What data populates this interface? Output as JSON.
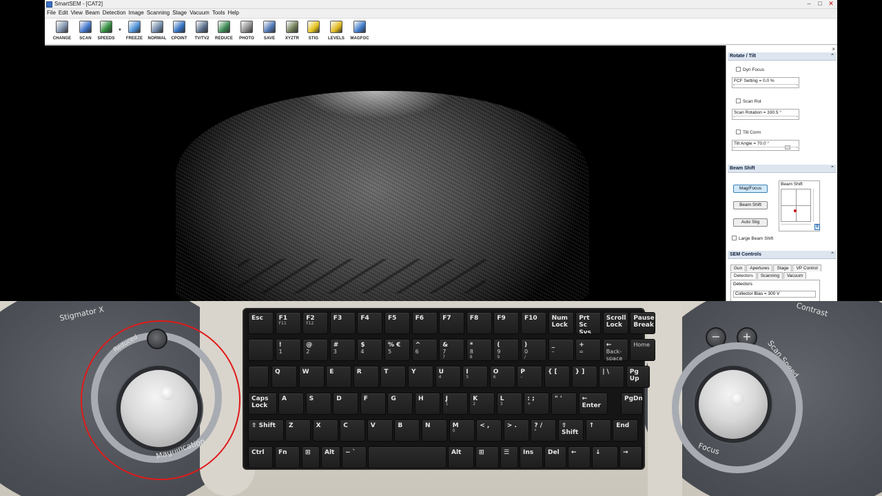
{
  "window": {
    "title": "SmartSEM - [CAT2]",
    "controls": {
      "minimize": "–",
      "maximize": "□",
      "close": "✕"
    }
  },
  "menu": [
    "File",
    "Edit",
    "View",
    "Beam",
    "Detection",
    "Image",
    "Scanning",
    "Stage",
    "Vacuum",
    "Tools",
    "Help"
  ],
  "toolbar": [
    {
      "label": "CHANGE",
      "icon": "change-icon",
      "color": "#7d8fa8"
    },
    {
      "label": "SCAN",
      "icon": "scan-icon",
      "color": "#3f73c8"
    },
    {
      "label": "SPEEDS",
      "icon": "speeds-icon",
      "color": "#2e8a3a"
    },
    {
      "label": "FREEZE",
      "icon": "freeze-icon",
      "color": "#4c8fd6"
    },
    {
      "label": "NORMAL",
      "icon": "normal-icon",
      "color": "#6f88a8"
    },
    {
      "label": "CPOINT",
      "icon": "cpoint-icon",
      "color": "#2f6fbf"
    },
    {
      "label": "TV/TV2",
      "icon": "tv-icon",
      "color": "#5a6f8c"
    },
    {
      "label": "REDUCE",
      "icon": "reduce-icon",
      "color": "#3c8a54"
    },
    {
      "label": "PHOTO",
      "icon": "photo-icon",
      "color": "#8a8a8a"
    },
    {
      "label": "SAVE",
      "icon": "save-icon",
      "color": "#4f75b5"
    },
    {
      "label": "XYZTR",
      "icon": "xyztr-icon",
      "color": "#6e7b55"
    },
    {
      "label": "STIG",
      "icon": "stig-icon",
      "color": "#e3c21a"
    },
    {
      "label": "LEVELS",
      "icon": "levels-icon",
      "color": "#e0b81c"
    },
    {
      "label": "MAGFOC",
      "icon": "magfoc-icon",
      "color": "#3d79c9"
    }
  ],
  "toolbar_dropdown_glyph": "▼",
  "panel": {
    "close": "×",
    "rotate_tilt": {
      "title": "Rotate / Tilt",
      "dyn_focus": "Dyn Focus",
      "fcf_setting": "FCF Setting =  0.0 %",
      "scan_rot": "Scan Rot",
      "scan_rotation": "Scan Rotation = 330.5 °",
      "tilt_corrn": "Tilt Corrn",
      "tilt_angle": "Tilt Angle =  70.0 °"
    },
    "beam_shift": {
      "title": "Beam Shift",
      "mag_focus": "Mag/Focus",
      "beam_shift_btn": "Beam Shift",
      "auto_stig": "Auto Stig",
      "large_beam_shift": "Large Beam Shift",
      "box_label": "Beam Shift",
      "zero": "0"
    },
    "sem_controls": {
      "title": "SEM Controls",
      "tabs_row1": [
        "Gun",
        "Apertures",
        "Stage",
        "VP Control"
      ],
      "tabs_row2": [
        "Detectors",
        "Scanning",
        "Vacuum"
      ],
      "detectors_label": "Detectors",
      "collector_bias": "Collector Bias =   300 V"
    }
  },
  "hardware": {
    "left_labels": {
      "stigmator": "Stigmator X",
      "reduced": "Reduced",
      "magnification": "Magnification"
    },
    "right_labels": {
      "contrast": "Contrast",
      "scan_speed": "Scan Speed",
      "focus": "Focus",
      "minus": "−",
      "plus": "+"
    },
    "highlight_color": "#e01a1a"
  },
  "keyboard": {
    "row1": [
      "Esc",
      "F1",
      "F2",
      "F3",
      "F4",
      "F5",
      "F6",
      "F7",
      "F8",
      "F9",
      "F10",
      "Num Lock",
      "Prt Sc Sys Rq",
      "Scroll Lock",
      "Pause Break"
    ],
    "row1_fn": [
      "",
      "F11",
      "F12",
      "",
      "",
      "",
      "",
      "",
      "",
      "",
      "",
      "",
      "",
      "",
      ""
    ],
    "row2": [
      {
        "top": "",
        "main": "",
        "sub": ""
      },
      {
        "top": "!",
        "main": "1",
        "sub": ""
      },
      {
        "top": "@",
        "main": "2",
        "sub": ""
      },
      {
        "top": "#",
        "main": "3",
        "sub": ""
      },
      {
        "top": "$",
        "main": "4",
        "sub": ""
      },
      {
        "top": "% €",
        "main": "5",
        "sub": ""
      },
      {
        "top": "^",
        "main": "6",
        "sub": ""
      },
      {
        "top": "&",
        "main": "7",
        "sub": "7"
      },
      {
        "top": "*",
        "main": "8",
        "sub": "8"
      },
      {
        "top": "(",
        "main": "9",
        "sub": "9"
      },
      {
        "top": ")",
        "main": "0",
        "sub": "/"
      },
      {
        "top": "_",
        "main": "–",
        "sub": ""
      },
      {
        "top": "+",
        "main": "=",
        "sub": ""
      },
      {
        "top": "←",
        "main": "Back-space",
        "sub": ""
      },
      {
        "top": "",
        "main": "Home",
        "sub": ""
      }
    ],
    "row3": [
      "Q",
      "W",
      "E",
      "R",
      "T",
      "Y",
      "U",
      "I",
      "O",
      "P",
      "{ [",
      "} ]",
      "| \\",
      "Pg Up"
    ],
    "row3_sub": [
      "",
      "",
      "",
      "",
      "",
      "",
      "4",
      "5",
      "6",
      "–",
      "",
      "",
      "",
      ""
    ],
    "row4": [
      "Caps Lock",
      "A",
      "S",
      "D",
      "F",
      "G",
      "H",
      "J",
      "K",
      "L",
      ": ;",
      "\" '",
      "← Enter",
      "PgDn"
    ],
    "row4_sub": [
      "",
      "",
      "",
      "",
      "",
      "",
      "",
      "1",
      "2",
      "3",
      "+",
      "",
      "",
      ""
    ],
    "row5": [
      "⇧ Shift",
      "Z",
      "X",
      "C",
      "V",
      "B",
      "N",
      "M",
      "< ,",
      "> .",
      "? /",
      "⇧ Shift",
      "↑",
      "End"
    ],
    "row5_sub": [
      "",
      "",
      "",
      "",
      "",
      "",
      "",
      "0",
      "",
      "",
      "*",
      "",
      "",
      ""
    ],
    "row6": [
      "Ctrl",
      "Fn",
      "⊞",
      "Alt",
      "~ `",
      "",
      "Alt",
      "⊞",
      "☰",
      "Ins",
      "Del",
      "←",
      "↓",
      "→"
    ]
  }
}
